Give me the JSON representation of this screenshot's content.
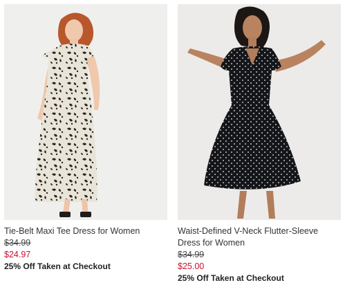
{
  "products": [
    {
      "title": "Tie-Belt Maxi Tee Dress for Women",
      "original_price": "$34.99",
      "sale_price": "$24.97",
      "promo": "25% Off Taken at Checkout",
      "sale_color": "#c8102e"
    },
    {
      "title": "Waist-Defined V-Neck Flutter-Sleeve Dress for Women",
      "original_price": "$34.99",
      "sale_price": "$25.00",
      "promo": "25% Off Taken at Checkout",
      "sale_color": "#c8102e"
    }
  ]
}
